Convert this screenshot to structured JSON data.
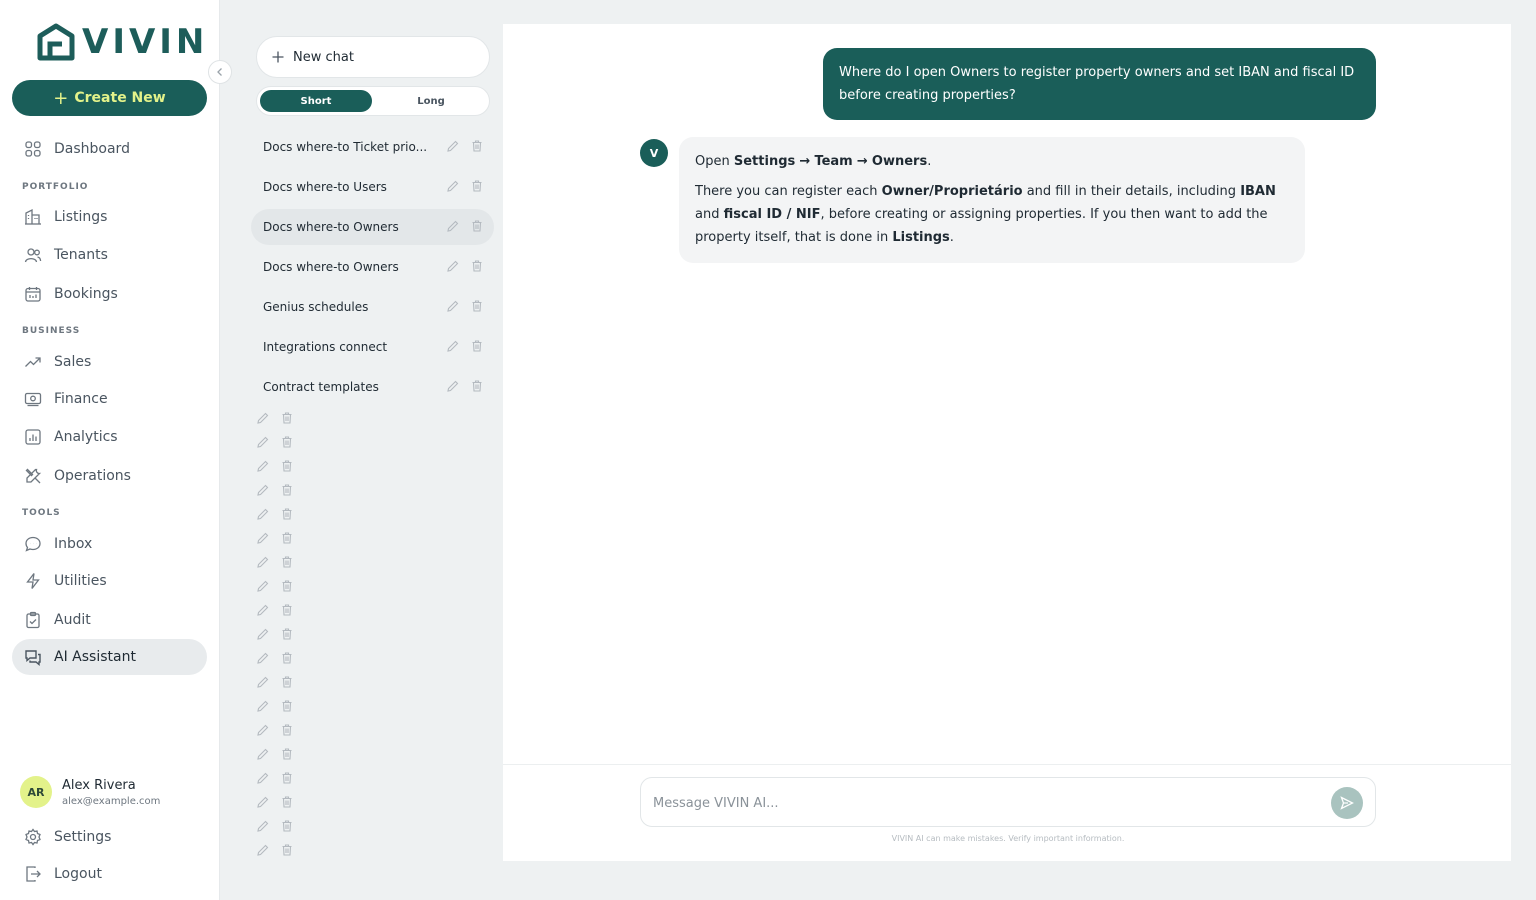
{
  "brand": {
    "name": "VIVIN",
    "color": "#1a5e59",
    "accent": "#e3f28a"
  },
  "sidebar": {
    "create_label": "Create New",
    "items": [
      {
        "label": "Dashboard",
        "icon": "grid-icon"
      },
      {
        "label": "Listings",
        "icon": "building-icon"
      },
      {
        "label": "Tenants",
        "icon": "users-icon"
      },
      {
        "label": "Bookings",
        "icon": "calendar-icon"
      },
      {
        "label": "Sales",
        "icon": "trend-icon"
      },
      {
        "label": "Finance",
        "icon": "money-icon"
      },
      {
        "label": "Analytics",
        "icon": "chart-icon"
      },
      {
        "label": "Operations",
        "icon": "tools-icon"
      },
      {
        "label": "Inbox",
        "icon": "chat-icon"
      },
      {
        "label": "Utilities",
        "icon": "bolt-icon"
      },
      {
        "label": "Audit",
        "icon": "clipboard-icon"
      },
      {
        "label": "AI Assistant",
        "icon": "assistant-icon"
      }
    ],
    "sections": {
      "portfolio": "PORTFOLIO",
      "business": "BUSINESS",
      "tools": "TOOLS"
    },
    "active": "AI Assistant",
    "user": {
      "initials": "AR",
      "name": "Alex Rivera",
      "email": "alex@example.com"
    },
    "settings_label": "Settings",
    "logout_label": "Logout"
  },
  "conversations": {
    "new_chat_label": "New chat",
    "toggle": {
      "short": "Short",
      "long": "Long",
      "selected": "Short"
    },
    "items": [
      {
        "title": "Docs where-to Ticket prio..."
      },
      {
        "title": "Docs where-to Users"
      },
      {
        "title": "Docs where-to Owners",
        "active": true
      },
      {
        "title": "Docs where-to Owners"
      },
      {
        "title": "Genius schedules"
      },
      {
        "title": "Integrations connect"
      },
      {
        "title": "Contract templates"
      }
    ]
  },
  "chat": {
    "user_message": "Where do I open Owners to register property owners and set IBAN and fiscal ID before creating properties?",
    "bot_initial": "V",
    "bot": {
      "open": "Open",
      "settings": "Settings",
      "arrow": "→",
      "team": "Team",
      "owners": "Owners",
      "dot": ".",
      "p2_a": "There you can register each",
      "owner_prop": "Owner/Proprietário",
      "p2_b": "and fill in their details, including",
      "iban": "IBAN",
      "and": "and",
      "fiscal": "fiscal ID / NIF",
      "p2_c": ", before creating or assigning properties. If you then want to add the property itself, that is done in",
      "listings": "Listings"
    },
    "composer_placeholder": "Message VIVIN AI...",
    "disclaimer": "VIVIN AI can make mistakes. Verify important information."
  }
}
